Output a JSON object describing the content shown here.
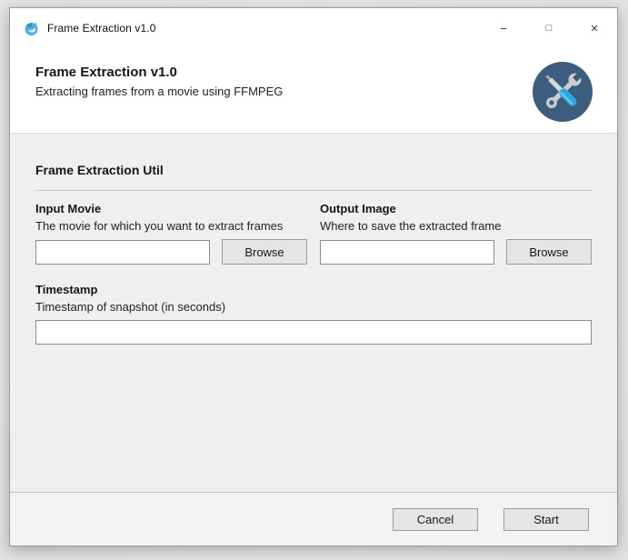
{
  "window": {
    "title": "Frame Extraction v1.0",
    "controls": {
      "minimize": "−",
      "maximize": "□",
      "close": "×"
    }
  },
  "header": {
    "title": "Frame Extraction v1.0",
    "subtitle": "Extracting frames from a movie using FFMPEG"
  },
  "main": {
    "section_title": "Frame Extraction Util",
    "input_movie": {
      "label": "Input Movie",
      "description": "The movie for which you want to extract frames",
      "value": "",
      "browse": "Browse"
    },
    "output_image": {
      "label": "Output Image",
      "description": "Where to save the extracted frame",
      "value": "",
      "browse": "Browse"
    },
    "timestamp": {
      "label": "Timestamp",
      "description": "Timestamp of snapshot (in seconds)",
      "value": ""
    }
  },
  "footer": {
    "cancel": "Cancel",
    "start": "Start"
  },
  "icons": {
    "app": "splash-icon",
    "badge": "wrench-screwdriver-icon"
  },
  "colors": {
    "badge_circle": "#3e5c7e",
    "screwdriver_handle": "#29a8e0",
    "tool_metal": "#c9cdd2",
    "app_icon_blue": "#55aee1",
    "app_icon_blue_dark": "#2f8fd0"
  }
}
